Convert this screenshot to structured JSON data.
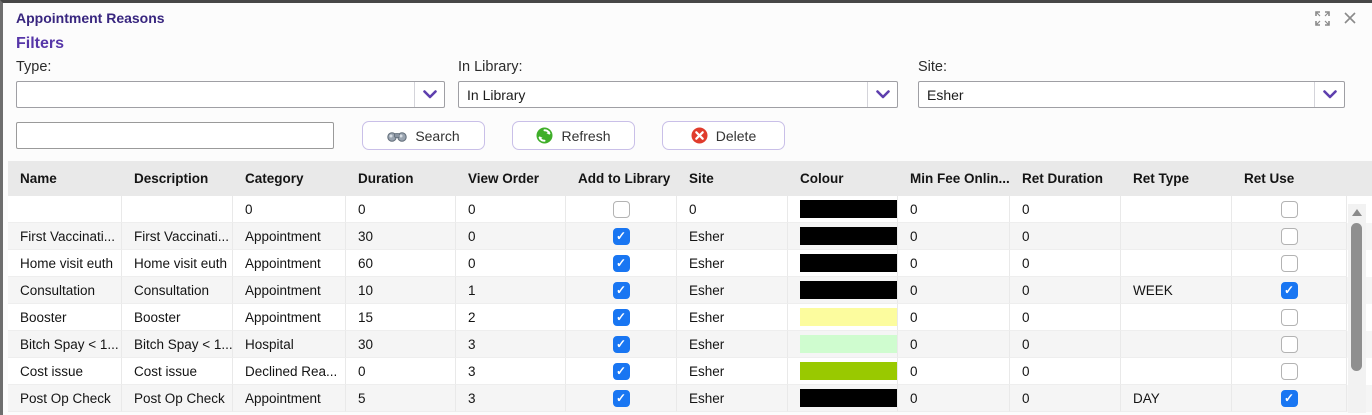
{
  "window": {
    "title": "Appointment Reasons"
  },
  "icons": {
    "titlebar": [
      "expand-icon",
      "close-icon"
    ],
    "dropdown": "chevron-down-icon",
    "search_button": "binoculars-icon",
    "refresh_button": "refresh-icon",
    "delete_button": "delete-icon"
  },
  "colors": {
    "title_purple": "#38267f",
    "heading_purple": "#5636a8",
    "chevron_purple": "#5e3fae",
    "checkbox_blue": "#1976f2",
    "header_bg": "#e9e9e9",
    "row_alt_bg": "#f5f5f5"
  },
  "filters": {
    "heading": "Filters",
    "type": {
      "label": "Type:",
      "value": ""
    },
    "in_library": {
      "label": "In Library:",
      "value": "In Library"
    },
    "site": {
      "label": "Site:",
      "value": "Esher"
    }
  },
  "toolbar": {
    "search_value": "",
    "search_label": "Search",
    "refresh_label": "Refresh",
    "delete_label": "Delete"
  },
  "table": {
    "columns": [
      "Name",
      "Description",
      "Category",
      "Duration",
      "View Order",
      "Add to Library",
      "Site",
      "Colour",
      "Min Fee Onlin...",
      "Ret Duration",
      "Ret Type",
      "Ret Use"
    ],
    "rows": [
      {
        "name": "",
        "description": "",
        "category": "0",
        "duration": "0",
        "view_order": "0",
        "add_to_library": false,
        "site": "0",
        "colour": "#000000",
        "min_fee": "0",
        "ret_duration": "0",
        "ret_type": "",
        "ret_use": false
      },
      {
        "name": "First Vaccinati...",
        "description": "First Vaccinati...",
        "category": "Appointment",
        "duration": "30",
        "view_order": "0",
        "add_to_library": true,
        "site": "Esher",
        "colour": "#000000",
        "min_fee": "0",
        "ret_duration": "0",
        "ret_type": "",
        "ret_use": false
      },
      {
        "name": "Home visit euth",
        "description": "Home visit euth",
        "category": "Appointment",
        "duration": "60",
        "view_order": "0",
        "add_to_library": true,
        "site": "Esher",
        "colour": "#000000",
        "min_fee": "0",
        "ret_duration": "0",
        "ret_type": "",
        "ret_use": false
      },
      {
        "name": "Consultation",
        "description": "Consultation",
        "category": "Appointment",
        "duration": "10",
        "view_order": "1",
        "add_to_library": true,
        "site": "Esher",
        "colour": "#000000",
        "min_fee": "0",
        "ret_duration": "0",
        "ret_type": "WEEK",
        "ret_use": true
      },
      {
        "name": "Booster",
        "description": "Booster",
        "category": "Appointment",
        "duration": "15",
        "view_order": "2",
        "add_to_library": true,
        "site": "Esher",
        "colour": "#fcfc9e",
        "min_fee": "0",
        "ret_duration": "0",
        "ret_type": "",
        "ret_use": false
      },
      {
        "name": "Bitch Spay < 1...",
        "description": "Bitch Spay < 1...",
        "category": "Hospital",
        "duration": "30",
        "view_order": "3",
        "add_to_library": true,
        "site": "Esher",
        "colour": "#cffccf",
        "min_fee": "0",
        "ret_duration": "0",
        "ret_type": "",
        "ret_use": false
      },
      {
        "name": "Cost issue",
        "description": "Cost issue",
        "category": "Declined Rea...",
        "duration": "0",
        "view_order": "3",
        "add_to_library": true,
        "site": "Esher",
        "colour": "#99c900",
        "min_fee": "0",
        "ret_duration": "0",
        "ret_type": "",
        "ret_use": false
      },
      {
        "name": "Post Op Check",
        "description": "Post Op Check",
        "category": "Appointment",
        "duration": "5",
        "view_order": "3",
        "add_to_library": true,
        "site": "Esher",
        "colour": "#000000",
        "min_fee": "0",
        "ret_duration": "0",
        "ret_type": "DAY",
        "ret_use": true
      }
    ]
  }
}
